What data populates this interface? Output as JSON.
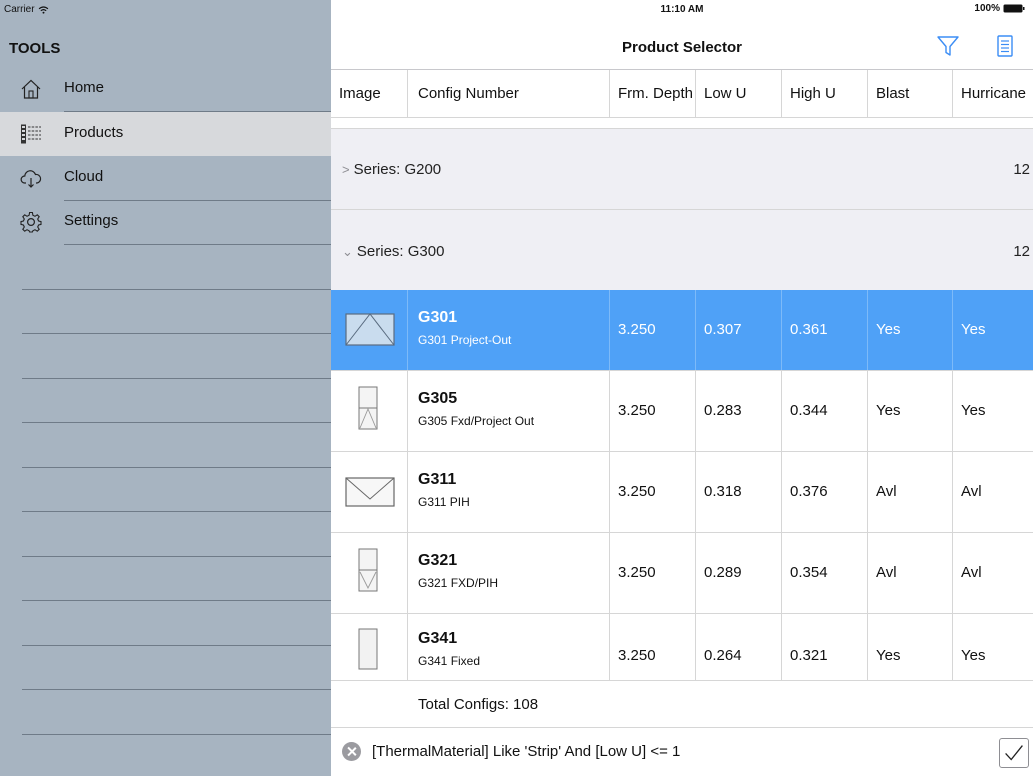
{
  "status": {
    "carrier": "Carrier",
    "time": "11:10 AM",
    "battery": "100%"
  },
  "sidebar": {
    "title": "TOOLS",
    "items": [
      {
        "label": "Home",
        "icon": "home-icon"
      },
      {
        "label": "Products",
        "icon": "products-list-icon"
      },
      {
        "label": "Cloud",
        "icon": "cloud-icon"
      },
      {
        "label": "Settings",
        "icon": "gear-icon"
      }
    ],
    "active_index": 1
  },
  "header": {
    "title": "Product Selector",
    "filter_icon": "filter-icon",
    "list_icon": "list-icon",
    "accent": "#3b8df5"
  },
  "columns": [
    "Image",
    "Config Number",
    "Frm. Depth",
    "Low U",
    "High U",
    "Blast",
    "Hurricane"
  ],
  "series": [
    {
      "label": "Series: G200",
      "count": "12",
      "expanded": false
    },
    {
      "label": "Series: G300",
      "count": "12",
      "expanded": true
    }
  ],
  "rows": [
    {
      "code": "G301",
      "desc": "G301 Project-Out",
      "depth": "3.250",
      "low_u": "0.307",
      "high_u": "0.361",
      "blast": "Yes",
      "hurricane": "Yes",
      "selected": true
    },
    {
      "code": "G305",
      "desc": "G305 Fxd/Project Out",
      "depth": "3.250",
      "low_u": "0.283",
      "high_u": "0.344",
      "blast": "Yes",
      "hurricane": "Yes"
    },
    {
      "code": "G311",
      "desc": "G311 PIH",
      "depth": "3.250",
      "low_u": "0.318",
      "high_u": "0.376",
      "blast": "Avl",
      "hurricane": "Avl"
    },
    {
      "code": "G321",
      "desc": "G321 FXD/PIH",
      "depth": "3.250",
      "low_u": "0.289",
      "high_u": "0.354",
      "blast": "Avl",
      "hurricane": "Avl"
    },
    {
      "code": "G341",
      "desc": "G341 Fixed",
      "depth": "3.250",
      "low_u": "0.264",
      "high_u": "0.321",
      "blast": "Yes",
      "hurricane": "Yes"
    }
  ],
  "footer": {
    "total": "Total Configs: 108",
    "filter_expression": "[ThermalMaterial] Like 'Strip' And [Low U] <= 1"
  },
  "colors": {
    "sidebar_bg": "#a7b4c1",
    "selected_row": "#4fa1f7",
    "series_bg": "#efeff4"
  }
}
